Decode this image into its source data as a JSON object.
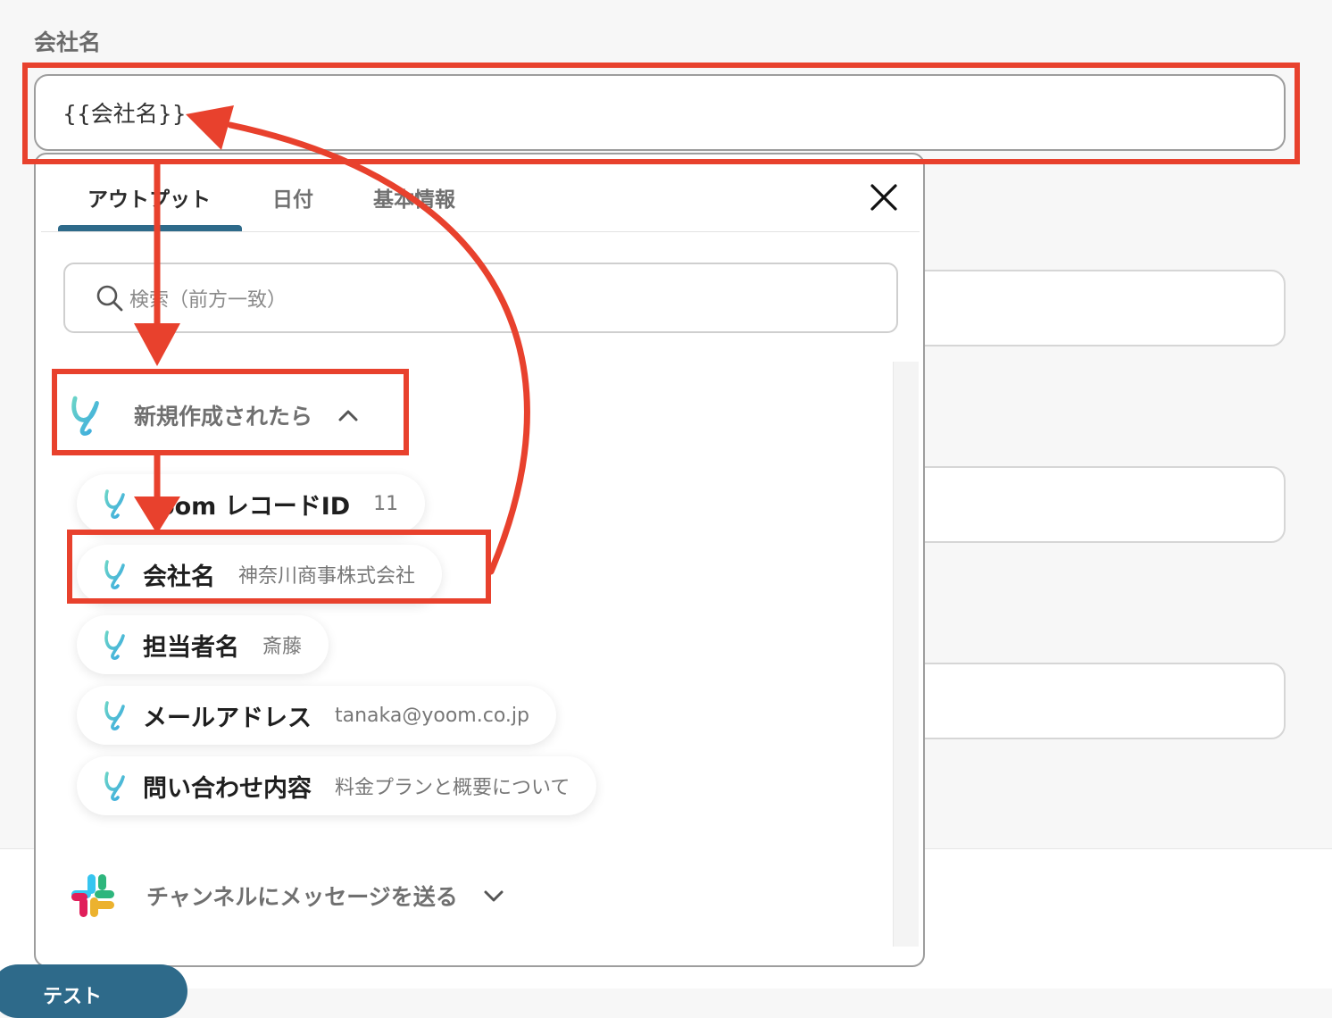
{
  "field": {
    "label": "会社名",
    "value": "{{会社名}}"
  },
  "popup": {
    "tabs": [
      {
        "label": "アウトプット",
        "active": true
      },
      {
        "label": "日付",
        "active": false
      },
      {
        "label": "基本情報",
        "active": false
      }
    ],
    "close_icon": "close-icon",
    "search_placeholder": "検索（前方一致）",
    "group": {
      "title": "新規作成されたら",
      "expanded": true,
      "items": [
        {
          "label": "Yoom レコードID",
          "value": "11"
        },
        {
          "label": "会社名",
          "value": "神奈川商事株式会社"
        },
        {
          "label": "担当者名",
          "value": "斎藤"
        },
        {
          "label": "メールアドレス",
          "value": "tanaka@yoom.co.jp"
        },
        {
          "label": "問い合わせ内容",
          "value": "料金プランと概要について"
        }
      ]
    },
    "group2": {
      "title": "チャンネルにメッセージを送る",
      "expanded": false
    }
  },
  "bottom_button": {
    "label": "テスト"
  },
  "colors": {
    "highlight": "#e8412d",
    "tab_accent": "#2e6a8a",
    "yoom_icon": "#4fc3d9"
  }
}
